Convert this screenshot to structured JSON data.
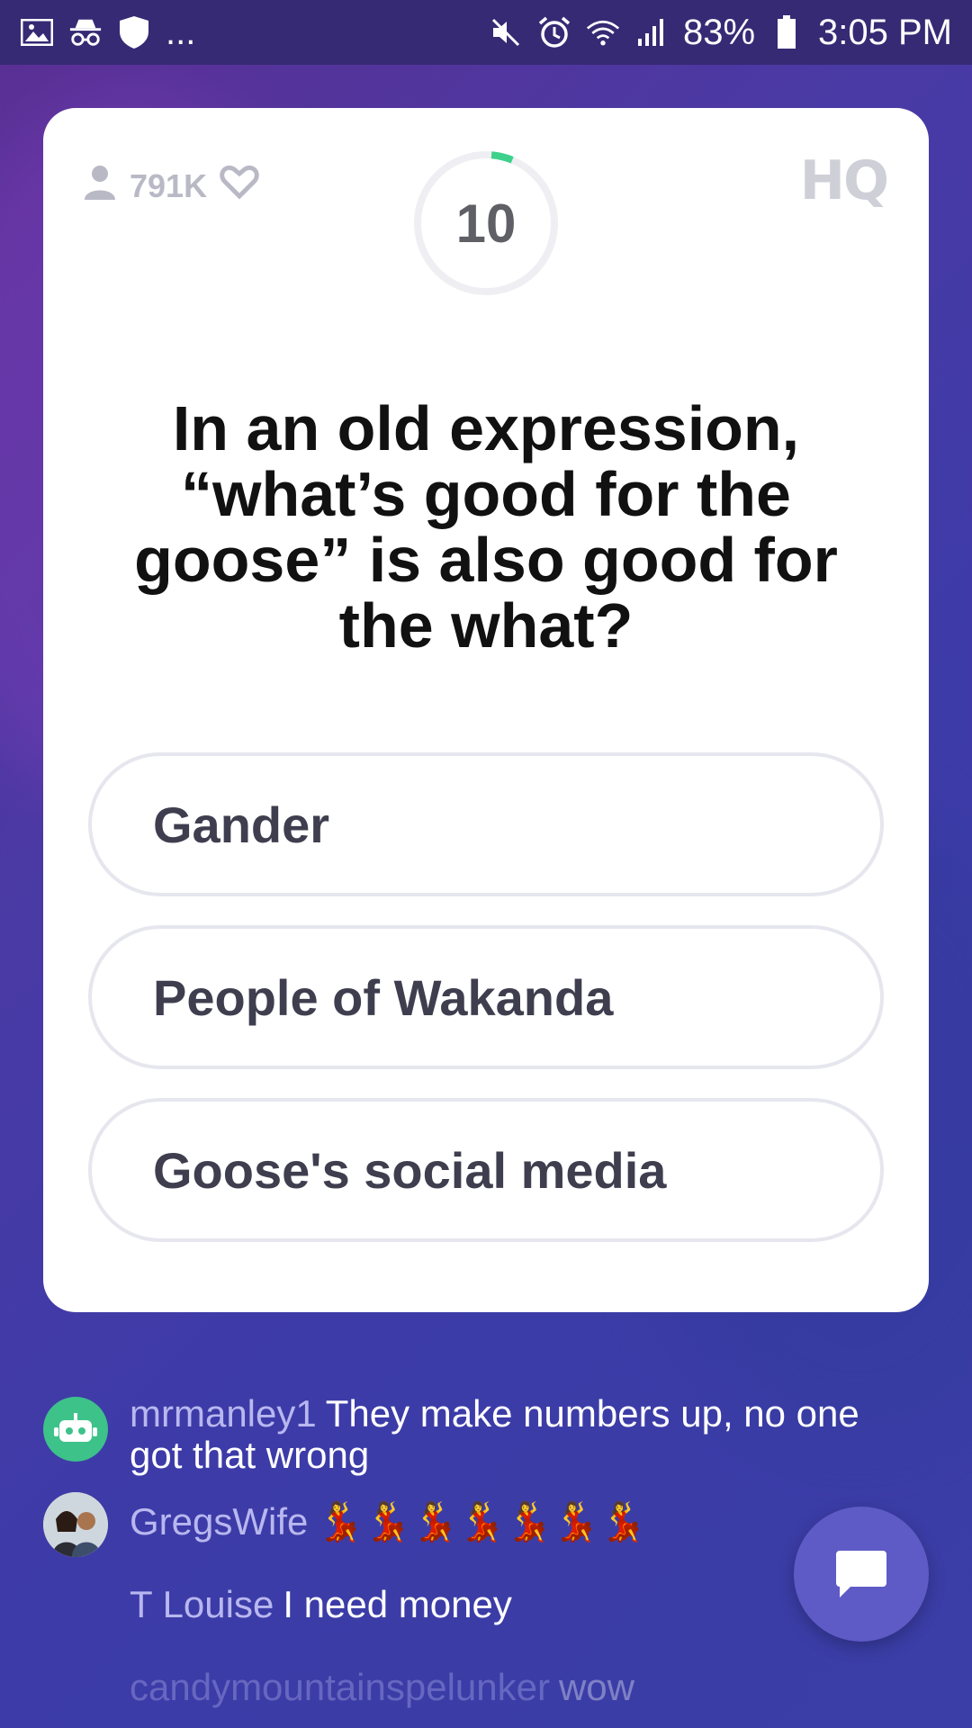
{
  "status_bar": {
    "battery": "83%",
    "time": "3:05 PM",
    "left_extra": "..."
  },
  "game": {
    "viewers": "791K",
    "logo": "HQ",
    "timer": "10",
    "timer_remaining_fraction": 0.95,
    "question": "In an old expression, “what’s good for the goose” is also good for the what?",
    "answers": [
      "Gander",
      "People of Wakanda",
      "Goose's social media"
    ]
  },
  "chat": {
    "messages": [
      {
        "user": "mrmanley1",
        "text": "They make numbers up, no one got that wrong"
      },
      {
        "user": "GregsWife",
        "text": "💃💃💃💃💃💃💃"
      },
      {
        "user": "T Louise",
        "text": "I need money"
      },
      {
        "user": "candymountainspelunker",
        "text": "wow"
      }
    ]
  },
  "colors": {
    "accent_green": "#3dd18b",
    "chat_button": "#5e5bc6"
  }
}
